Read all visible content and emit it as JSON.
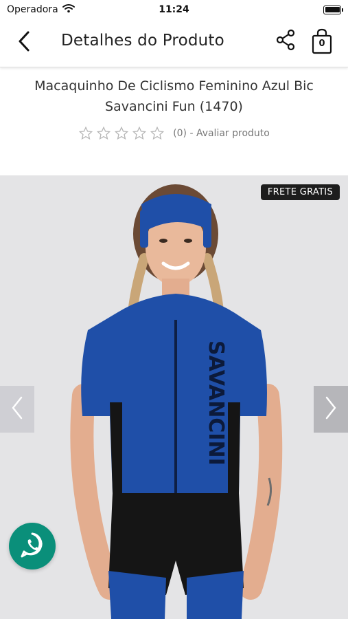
{
  "status_bar": {
    "carrier": "Operadora",
    "time": "11:24"
  },
  "header": {
    "title": "Detalhes do Produto",
    "cart_count": "0"
  },
  "product": {
    "title": "Macaquinho De Ciclismo Feminino Azul Bic Savancini Fun (1470)",
    "rating_stars": 0,
    "rating_max": 5,
    "rating_text": "(0) - Avaliar produto",
    "badge": "FRETE GRATIS",
    "image_brand_print": "SAVANCINI",
    "colors": {
      "jersey_blue": "#1f4fa8",
      "shorts_black": "#151515",
      "background": "#e4e4e6",
      "whatsapp": "#0a8f7a"
    }
  },
  "icons": {
    "back": "chevron-left-icon",
    "share": "share-icon",
    "cart": "shopping-bag-icon",
    "prev": "chevron-left-icon",
    "next": "chevron-right-icon",
    "whatsapp": "whatsapp-icon"
  }
}
